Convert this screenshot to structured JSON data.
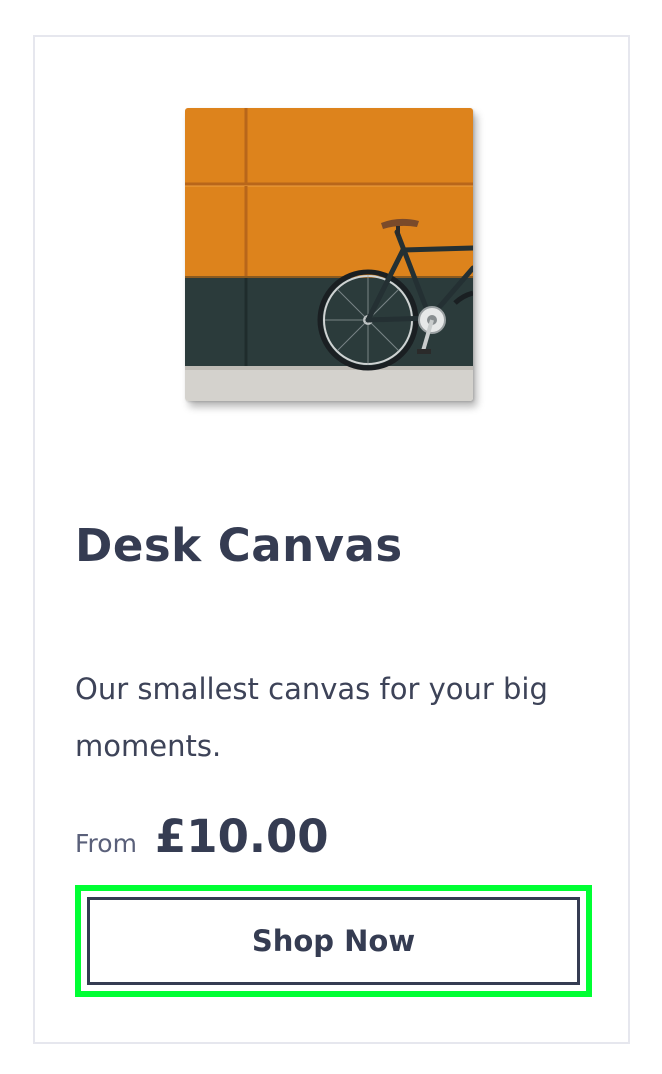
{
  "product": {
    "title": "Desk Canvas",
    "description": "Our smallest canvas for your big moments.",
    "price_prefix": "From",
    "price": "£10.00",
    "cta_label": "Shop Now",
    "image_alt": "Canvas print of a bicycle leaning against an orange and dark green wall",
    "image_icon": "canvas-print-image"
  },
  "colors": {
    "text": "#353c52",
    "card_border": "#e6e7ee",
    "highlight": "#00ff33",
    "wall_orange": "#e0861f",
    "wall_green": "#2b3b3b"
  }
}
